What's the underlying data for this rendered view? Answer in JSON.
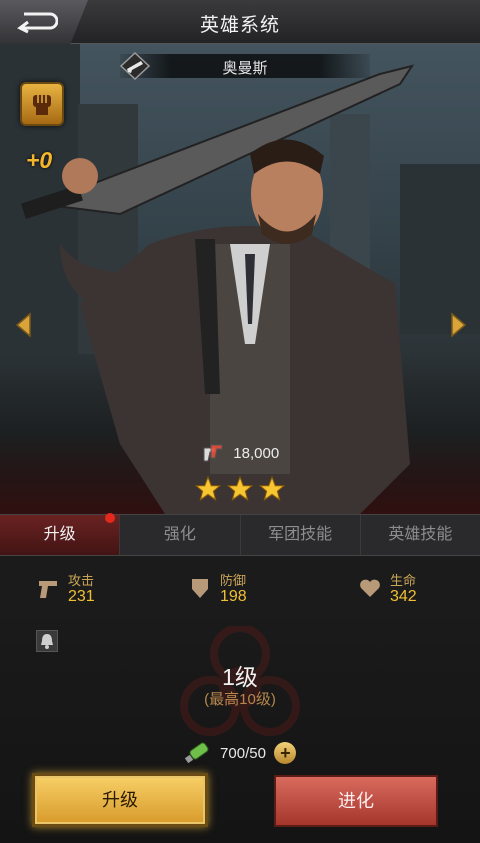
{
  "header": {
    "title": "英雄系统"
  },
  "hero": {
    "name": "奥曼斯",
    "bonus": "+0",
    "power": "18,000",
    "stars": 3
  },
  "tabs": [
    {
      "label": "升级",
      "active": true,
      "notification": true
    },
    {
      "label": "强化",
      "active": false
    },
    {
      "label": "军团技能",
      "active": false
    },
    {
      "label": "英雄技能",
      "active": false
    }
  ],
  "stats": {
    "attack": {
      "label": "攻击",
      "value": "231"
    },
    "defense": {
      "label": "防御",
      "value": "198"
    },
    "hp": {
      "label": "生命",
      "value": "342"
    }
  },
  "level": {
    "title": "1级",
    "max": "(最高10级)",
    "cost": "700/50"
  },
  "buttons": {
    "upgrade": "升级",
    "evolve": "进化"
  },
  "colors": {
    "accent_gold": "#f0c032",
    "tab_active": "#6a2222",
    "upgrade_button": "#f0c04e",
    "evolve_button": "#c6483c"
  },
  "icons": [
    "back-icon",
    "rifle-icon",
    "fist-icon",
    "chevron-left-icon",
    "chevron-right-icon",
    "pistols-icon",
    "star-icon",
    "gun-icon",
    "shield-icon",
    "heart-icon",
    "bell-icon",
    "biohazard-icon",
    "green-vial-icon",
    "plus-icon"
  ]
}
